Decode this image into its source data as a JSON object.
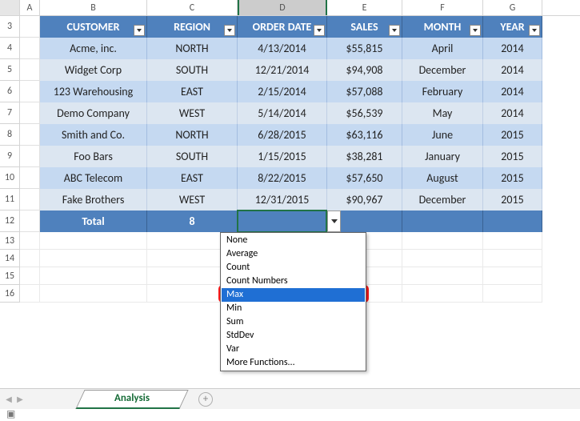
{
  "domain": "Computer-Use",
  "columns": [
    "A",
    "B",
    "C",
    "D",
    "E",
    "F",
    "G"
  ],
  "selected_column": "D",
  "rows_visible": [
    3,
    4,
    5,
    6,
    7,
    8,
    9,
    10,
    11,
    12,
    13,
    14,
    15,
    16
  ],
  "table": {
    "headers": [
      "CUSTOMER",
      "REGION",
      "ORDER DATE",
      "SALES",
      "MONTH",
      "YEAR"
    ],
    "data": [
      {
        "customer": "Acme, inc.",
        "region": "NORTH",
        "order_date": "4/13/2014",
        "sales": "$55,815",
        "month": "April",
        "year": "2014"
      },
      {
        "customer": "Widget Corp",
        "region": "SOUTH",
        "order_date": "12/21/2014",
        "sales": "$94,908",
        "month": "December",
        "year": "2014"
      },
      {
        "customer": "123 Warehousing",
        "region": "EAST",
        "order_date": "2/15/2014",
        "sales": "$57,088",
        "month": "February",
        "year": "2014"
      },
      {
        "customer": "Demo Company",
        "region": "WEST",
        "order_date": "5/14/2014",
        "sales": "$56,539",
        "month": "May",
        "year": "2014"
      },
      {
        "customer": "Smith and Co.",
        "region": "NORTH",
        "order_date": "6/28/2015",
        "sales": "$63,116",
        "month": "June",
        "year": "2015"
      },
      {
        "customer": "Foo Bars",
        "region": "SOUTH",
        "order_date": "1/15/2015",
        "sales": "$38,281",
        "month": "January",
        "year": "2015"
      },
      {
        "customer": "ABC Telecom",
        "region": "EAST",
        "order_date": "8/22/2015",
        "sales": "$57,650",
        "month": "August",
        "year": "2015"
      },
      {
        "customer": "Fake Brothers",
        "region": "WEST",
        "order_date": "12/31/2015",
        "sales": "$90,967",
        "month": "December",
        "year": "2015"
      }
    ],
    "total_row": {
      "label": "Total",
      "count": "8"
    }
  },
  "selected_cell": "D12",
  "dropdown": {
    "items": [
      "None",
      "Average",
      "Count",
      "Count Numbers",
      "Max",
      "Min",
      "Sum",
      "StdDev",
      "Var",
      "More Functions..."
    ],
    "selected": "Max"
  },
  "sheet_tab": {
    "name": "Analysis"
  },
  "chart_data": null
}
